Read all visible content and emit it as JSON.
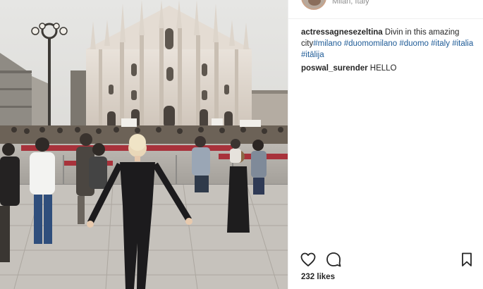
{
  "post": {
    "location": "Milan, Italy",
    "author": "actressagnesezeltina",
    "caption_text": " Divin in this amazing city",
    "caption_hashtags": [
      "#milano",
      "#duomomilano",
      "#duomo",
      "#italy",
      "#italia",
      "#itālija"
    ],
    "comment": {
      "user": "poswal_surender",
      "text": " HELLO"
    },
    "likes": "232 likes"
  },
  "icons": {
    "like": "heart-outline-icon",
    "comment": "speech-bubble-icon",
    "save": "bookmark-icon"
  },
  "colors": {
    "hashtag": "#1d5a96",
    "text": "#262626",
    "muted": "#8e8e8e"
  }
}
